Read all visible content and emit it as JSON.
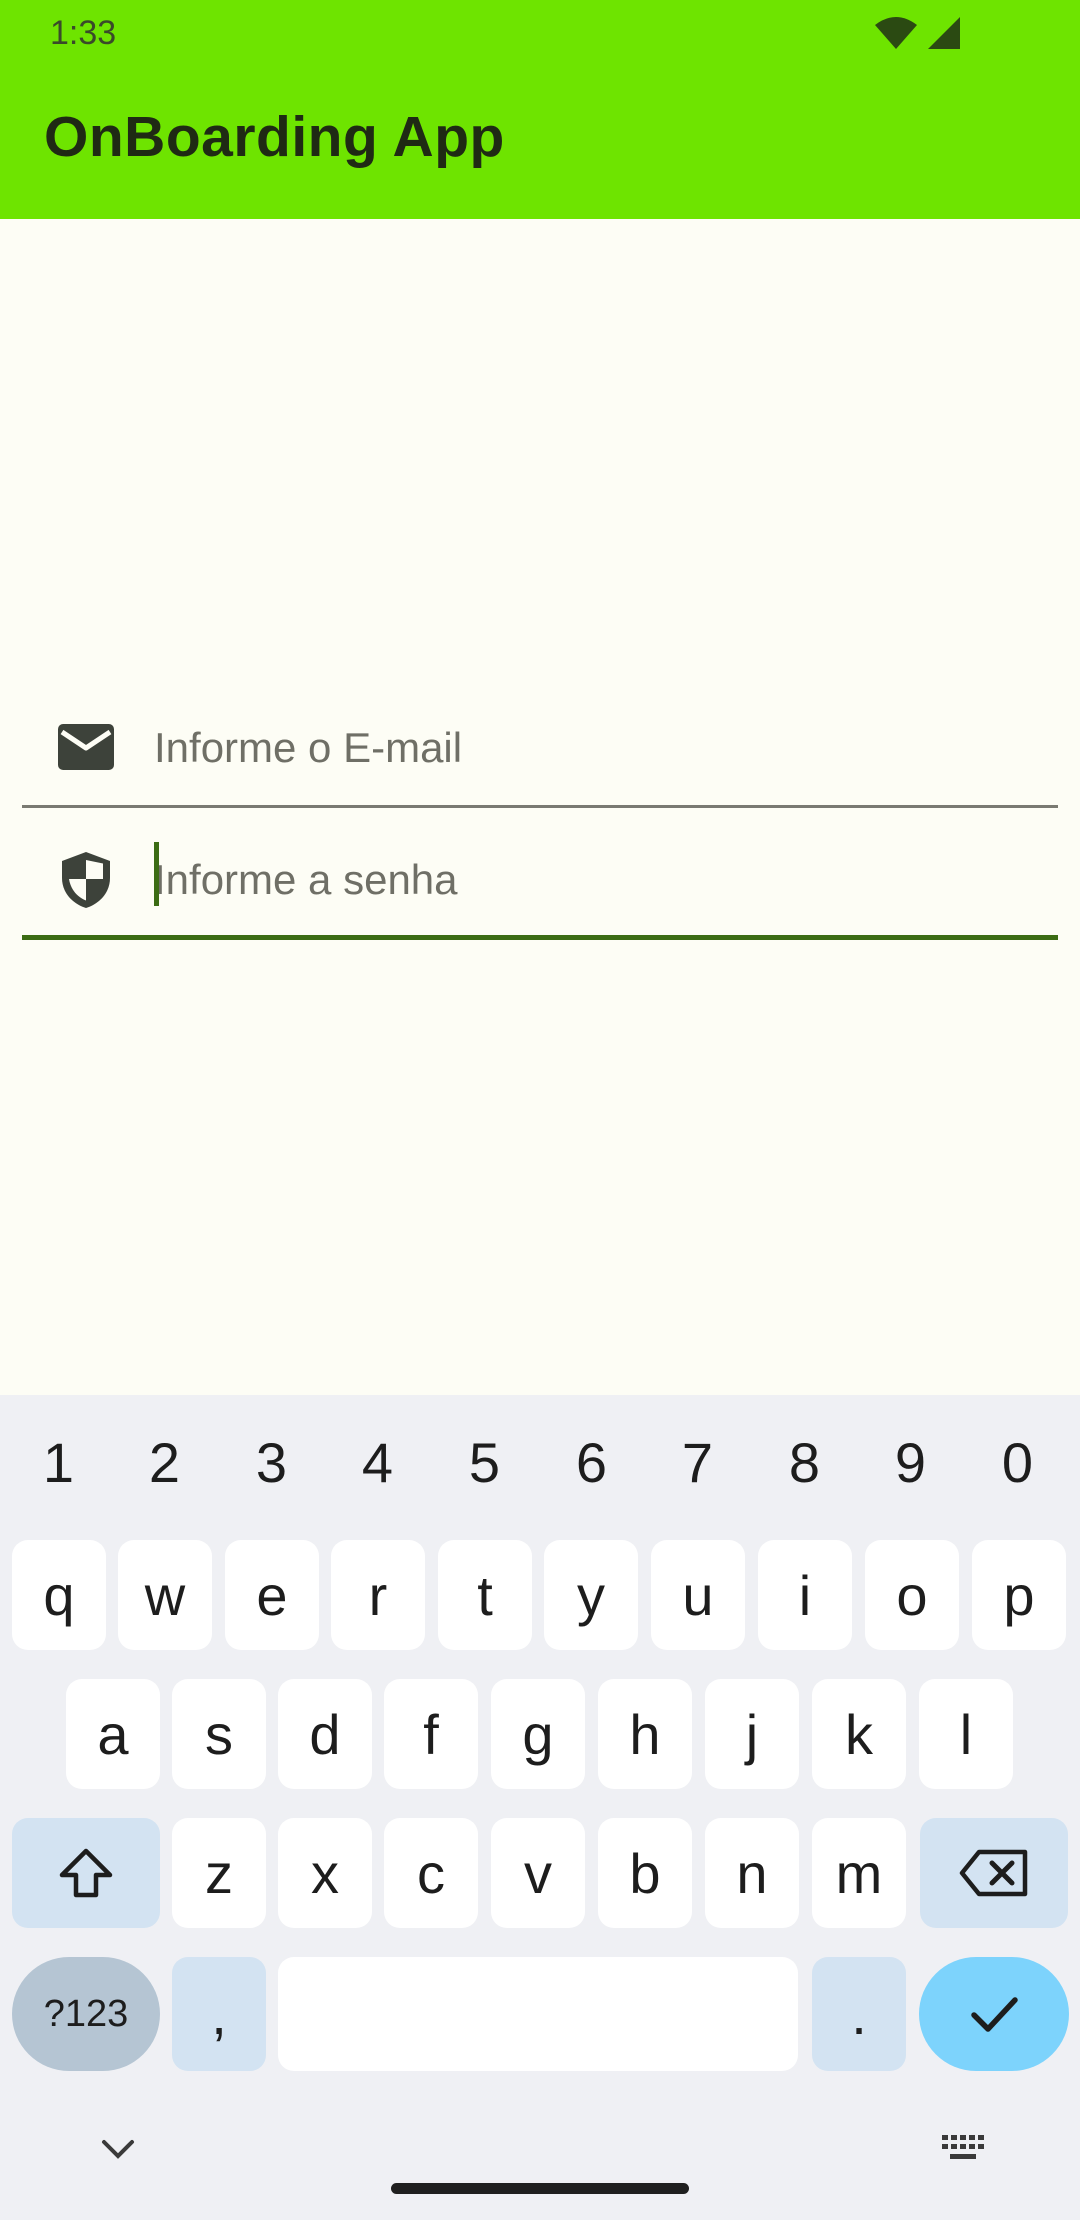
{
  "status_bar": {
    "time": "1:33",
    "icons": [
      "wifi-icon",
      "cellular-signal-icon"
    ]
  },
  "app_bar": {
    "title": "OnBoarding App",
    "color": "#6ee400"
  },
  "form": {
    "email": {
      "icon": "email-icon",
      "placeholder": "Informe o E-mail",
      "value": ""
    },
    "password": {
      "icon": "shield-icon",
      "placeholder": "Informe a senha",
      "value": "",
      "focused": true
    }
  },
  "keyboard": {
    "number_row": [
      "1",
      "2",
      "3",
      "4",
      "5",
      "6",
      "7",
      "8",
      "9",
      "0"
    ],
    "row1": [
      "q",
      "w",
      "e",
      "r",
      "t",
      "y",
      "u",
      "i",
      "o",
      "p"
    ],
    "row2": [
      "a",
      "s",
      "d",
      "f",
      "g",
      "h",
      "j",
      "k",
      "l"
    ],
    "row3": [
      "z",
      "x",
      "c",
      "v",
      "b",
      "n",
      "m"
    ],
    "symbols_label": "?123",
    "comma": ",",
    "period": ".",
    "shift_icon": "shift-icon",
    "backspace_icon": "backspace-icon",
    "enter_icon": "checkmark-icon"
  },
  "nav_bar": {
    "icons": [
      "chevron-down-icon",
      "home-handle",
      "keyboard-icon"
    ]
  }
}
